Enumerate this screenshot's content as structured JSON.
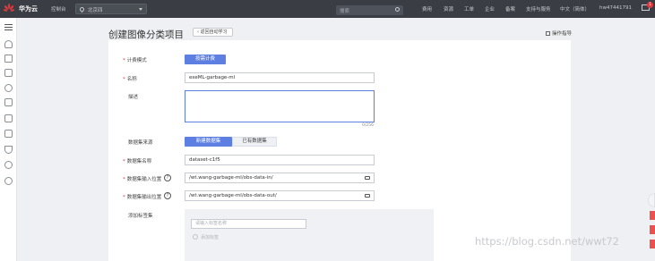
{
  "topbar": {
    "brand": "华为云",
    "console_link": "控制台",
    "region": "北京四",
    "search_placeholder": "搜索",
    "links": [
      "费用",
      "资源",
      "工单",
      "企业",
      "备案",
      "支持与服务",
      "中文（简体）",
      "hw47441791"
    ],
    "message_count": "1"
  },
  "sidebar": {
    "icons": [
      "cloud-icon",
      "warning-icon",
      "modelarts-icon",
      "cloud-service-icon",
      "document-icon",
      "copy-icon",
      "list-icon",
      "anchor-icon",
      "settings-icon",
      "help-circle-icon"
    ]
  },
  "header": {
    "title": "创建图像分类项目",
    "back_label": "返回自动学习",
    "guide_label": "操作指导"
  },
  "form": {
    "billing": {
      "label": "计费模式",
      "value": "按需计费"
    },
    "name": {
      "label": "名称",
      "value": "exeML-garbage-ml"
    },
    "description": {
      "label": "描述",
      "value": "",
      "counter": "0/256"
    },
    "dataset_source": {
      "label": "数据集来源",
      "options": [
        "新建数据集",
        "已有数据集"
      ],
      "selected": "新建数据集"
    },
    "dataset_name": {
      "label": "数据集名称",
      "value": "dataset-c1f5"
    },
    "input_location": {
      "label": "数据集输入位置",
      "value": "/wt.wang-garbage-ml/obs-data-in/"
    },
    "output_location": {
      "label": "数据集输出位置",
      "value": "/wt.wang-garbage-ml/obs-data-out/"
    },
    "tags": {
      "label": "添加标签集",
      "placeholder": "请输入标签名称",
      "add_label": "添加标签"
    }
  },
  "watermark": "https://blog.csdn.net/wwt72",
  "colors": {
    "topbar": "#3a3d43",
    "primary": "#5c7fe1",
    "required": "#e0393e"
  }
}
